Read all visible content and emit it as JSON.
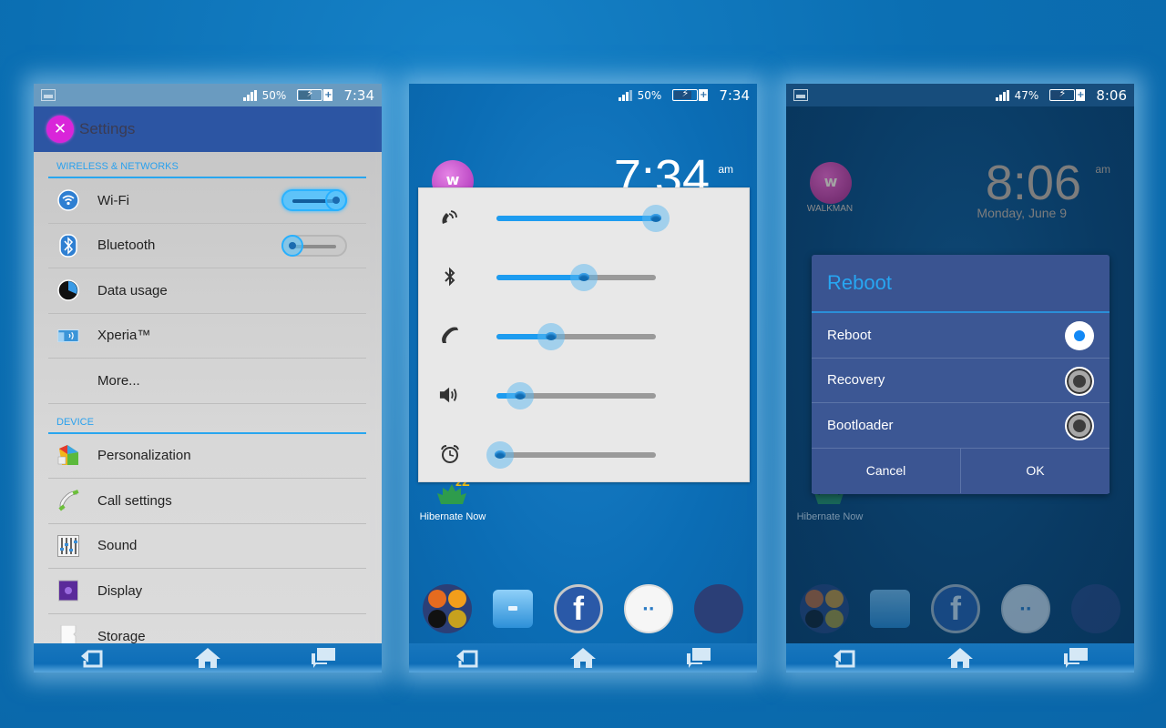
{
  "screens": [
    {
      "status_bar": {
        "signal_percent": "50%",
        "battery_charging": true,
        "time": "7:34",
        "notification_icon": "image-icon"
      },
      "header": {
        "title": "Settings",
        "icon": "tools-icon"
      },
      "sections": [
        {
          "title": "WIRELESS & NETWORKS",
          "items": [
            {
              "label": "Wi-Fi",
              "icon": "wifi-icon",
              "toggle": "on"
            },
            {
              "label": "Bluetooth",
              "icon": "bluetooth-icon",
              "toggle": "off"
            },
            {
              "label": "Data usage",
              "icon": "data-usage-icon"
            },
            {
              "label": "Xperia™",
              "icon": "xperia-connectivity-icon"
            },
            {
              "label": "More..."
            }
          ]
        },
        {
          "title": "DEVICE",
          "items": [
            {
              "label": "Personalization",
              "icon": "personalization-icon"
            },
            {
              "label": "Call settings",
              "icon": "phone-handset-icon"
            },
            {
              "label": "Sound",
              "icon": "equalizer-icon"
            },
            {
              "label": "Display",
              "icon": "display-icon"
            },
            {
              "label": "Storage",
              "icon": "sd-card-icon"
            }
          ]
        }
      ],
      "nav": [
        "back-icon",
        "home-icon",
        "recent-apps-icon"
      ]
    },
    {
      "status_bar": {
        "signal_percent": "50%",
        "battery_charging": true,
        "time": "7:34"
      },
      "clock": {
        "time": "7:34",
        "ampm": "am"
      },
      "volume_panel": [
        {
          "name": "ringtone",
          "icon": "ringtone-icon",
          "level_percent": 100
        },
        {
          "name": "bluetooth",
          "icon": "bluetooth-icon",
          "level_percent": 55
        },
        {
          "name": "call",
          "icon": "phone-handset-icon",
          "level_percent": 34
        },
        {
          "name": "media",
          "icon": "speaker-icon",
          "level_percent": 15
        },
        {
          "name": "alarm",
          "icon": "alarm-clock-icon",
          "level_percent": 2
        }
      ],
      "desktop_apps": [
        {
          "label": "Hibernate Now",
          "icon": "hibernate-leaf-icon"
        }
      ],
      "dock": [
        {
          "name": "app-folder-1",
          "icon": "folder-icon"
        },
        {
          "name": "file-manager",
          "icon": "file-cabinet-icon"
        },
        {
          "name": "facebook",
          "icon": "facebook-icon",
          "glyph": "f"
        },
        {
          "name": "messaging",
          "icon": "messaging-icon",
          "glyph": "··"
        },
        {
          "name": "games-folder",
          "icon": "folder-icon"
        }
      ]
    },
    {
      "status_bar": {
        "signal_percent": "47%",
        "battery_charging": true,
        "time": "8:06",
        "notification_icon": "image-icon"
      },
      "clock": {
        "time": "8:06",
        "ampm": "am",
        "date": "Monday, June 9"
      },
      "walkman_label": "WALKMAN",
      "desktop_apps": [
        {
          "label": "Hibernate Now"
        }
      ],
      "dialog": {
        "title": "Reboot",
        "options": [
          {
            "label": "Reboot",
            "selected": true
          },
          {
            "label": "Recovery",
            "selected": false
          },
          {
            "label": "Bootloader",
            "selected": false
          }
        ],
        "buttons": {
          "cancel": "Cancel",
          "ok": "OK"
        }
      }
    }
  ],
  "colors": {
    "accent": "#29a6ef",
    "settings_header": "#2c55a3",
    "dialog_bg": "#3a5491",
    "wallpaper": "#0b6db5"
  }
}
